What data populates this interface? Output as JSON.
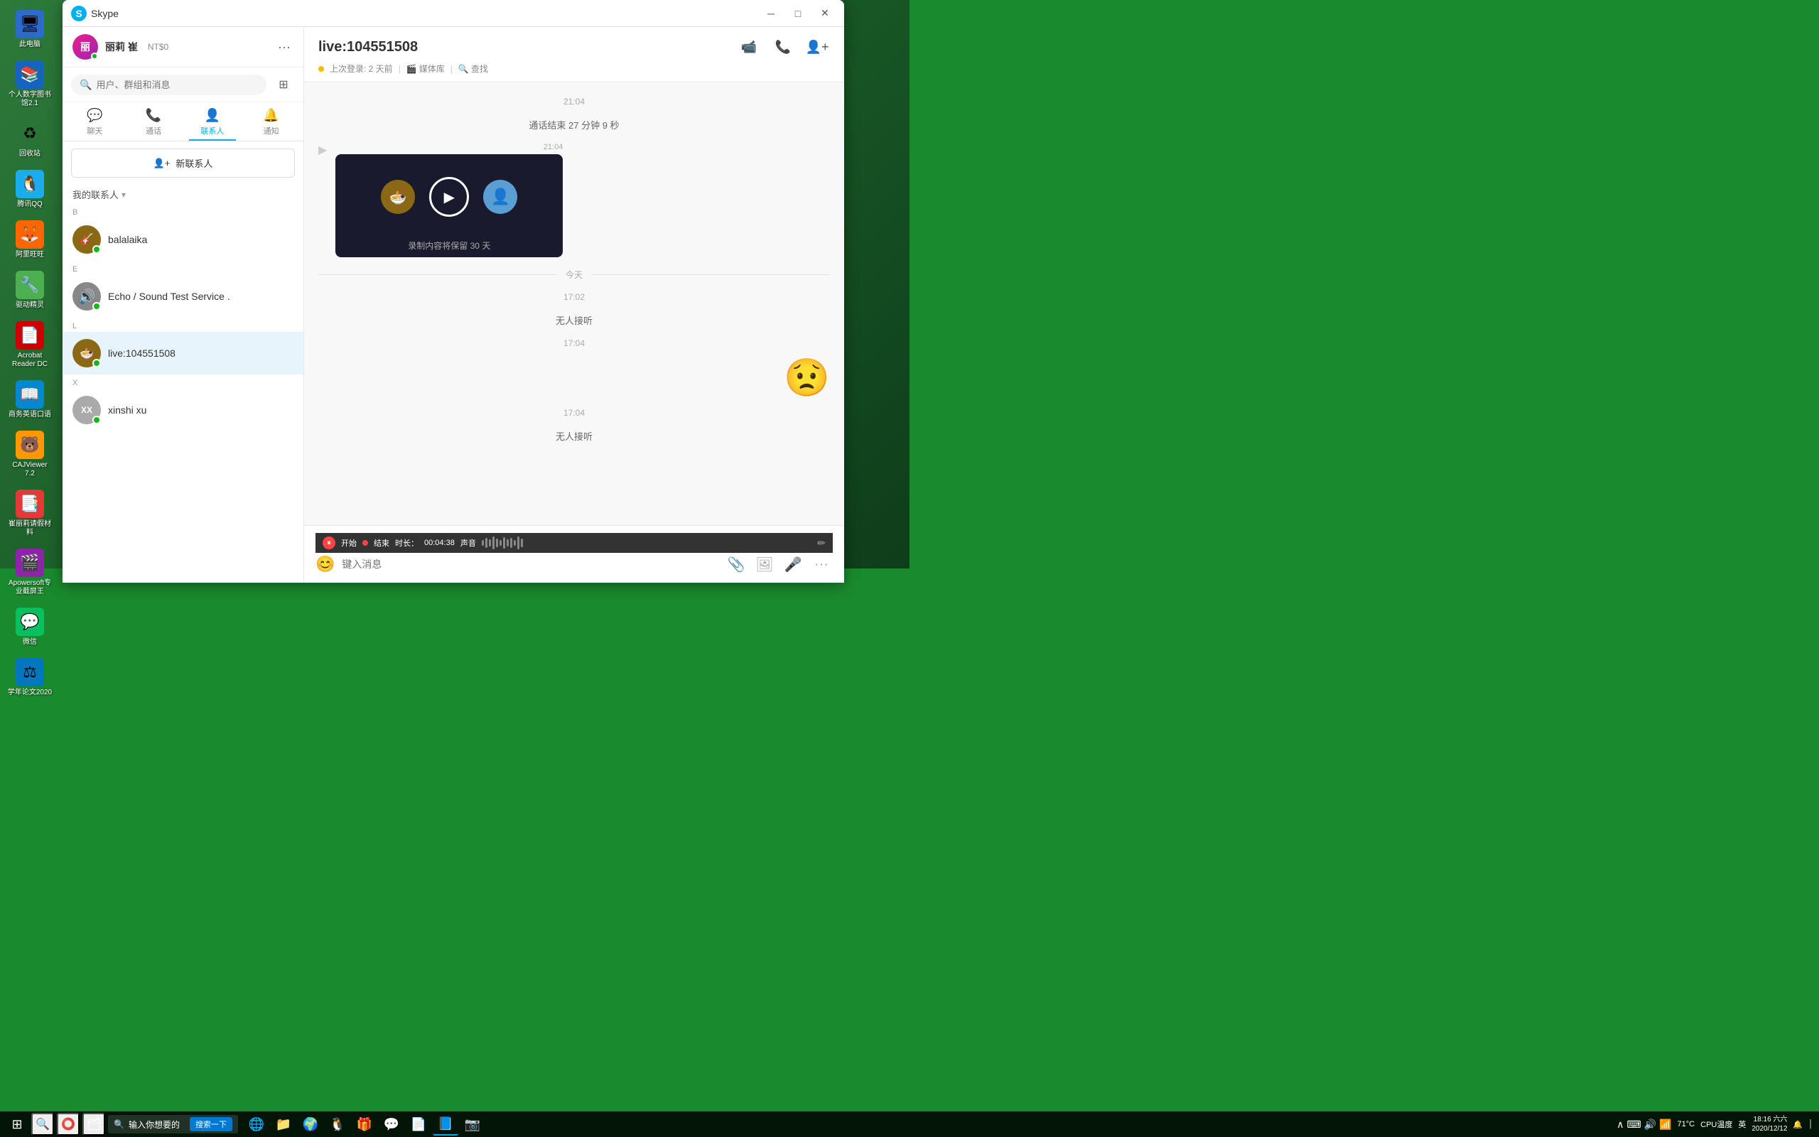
{
  "window": {
    "title": "Skype",
    "app_name": "Skype"
  },
  "user": {
    "name": "丽莉 崔",
    "initials": "丽",
    "balance": "NT$0",
    "status": "online"
  },
  "search": {
    "placeholder": "用户、群组和消息"
  },
  "nav_tabs": [
    {
      "id": "chat",
      "label": "聊天",
      "icon": "💬"
    },
    {
      "id": "call",
      "label": "通话",
      "icon": "📞"
    },
    {
      "id": "contacts",
      "label": "联系人",
      "icon": "👤",
      "active": true
    },
    {
      "id": "notify",
      "label": "通知",
      "icon": "🔔"
    }
  ],
  "new_contact_btn": "新联系人",
  "contacts_header": "我的联系人",
  "contacts": {
    "sections": [
      {
        "letter": "B",
        "items": [
          {
            "id": "balalaika",
            "name": "balalaika",
            "status": "online",
            "bg": "#8B6914"
          }
        ]
      },
      {
        "letter": "E",
        "items": [
          {
            "id": "echo",
            "name": "Echo / Sound Test Service .",
            "status": "online",
            "bg": "#888",
            "is_service": true
          }
        ]
      },
      {
        "letter": "L",
        "items": [
          {
            "id": "live104551508",
            "name": "live:104551508",
            "status": "online",
            "bg": "#8B6914",
            "active": true
          }
        ]
      },
      {
        "letter": "X",
        "items": [
          {
            "id": "xinshixu",
            "name": "xinshi xu",
            "status": "online",
            "bg": "#aaa",
            "initials": "XX"
          }
        ]
      }
    ]
  },
  "chat": {
    "contact_id": "live:104551508",
    "title": "live:104551508",
    "meta": {
      "last_login": "上次登录: 2 天前",
      "media": "媒体库",
      "search": "查找"
    },
    "messages": [
      {
        "type": "time",
        "value": "21:04"
      },
      {
        "type": "system",
        "value": "通话结束 27 分钟 9 秒"
      },
      {
        "type": "video_record",
        "time": "21:04",
        "note": "录制内容将保留 30 天"
      },
      {
        "type": "divider",
        "label": "今天"
      },
      {
        "type": "time",
        "side": "center",
        "value": "17:02"
      },
      {
        "type": "system",
        "value": "无人接听"
      },
      {
        "type": "time",
        "side": "center",
        "value": "17:04"
      },
      {
        "type": "emoji",
        "emoji": "😟",
        "time": "17:04"
      },
      {
        "type": "time",
        "side": "center",
        "value": "17:04"
      },
      {
        "type": "system",
        "value": "无人接听"
      }
    ],
    "input_placeholder": "键入消息"
  },
  "recording_bar": {
    "start_label": "开始",
    "end_label": "结束",
    "time_label": "时长：",
    "time_value": "00:04:38",
    "volume_label": "声音"
  },
  "taskbar": {
    "search_placeholder": "输入你想要的",
    "search_btn": "搜索一下",
    "apps": [
      {
        "id": "ie",
        "icon": "🌐",
        "active": false
      },
      {
        "id": "folder",
        "icon": "📁",
        "active": false
      },
      {
        "id": "chrome",
        "icon": "🌍",
        "active": false
      },
      {
        "id": "qq",
        "icon": "🐧",
        "active": false
      },
      {
        "id": "bonus",
        "icon": "🎁",
        "active": false
      },
      {
        "id": "navichat",
        "icon": "💬",
        "active": false
      },
      {
        "id": "pdf",
        "icon": "📄",
        "active": false
      },
      {
        "id": "skype",
        "icon": "📘",
        "active": true
      },
      {
        "id": "camera",
        "icon": "📷",
        "active": false
      }
    ],
    "sys_info": {
      "temp": "71°C",
      "cpu": "CPU温度",
      "time": "18:16",
      "day": "六六六",
      "date": "2020/12/12",
      "lang": "英"
    }
  }
}
